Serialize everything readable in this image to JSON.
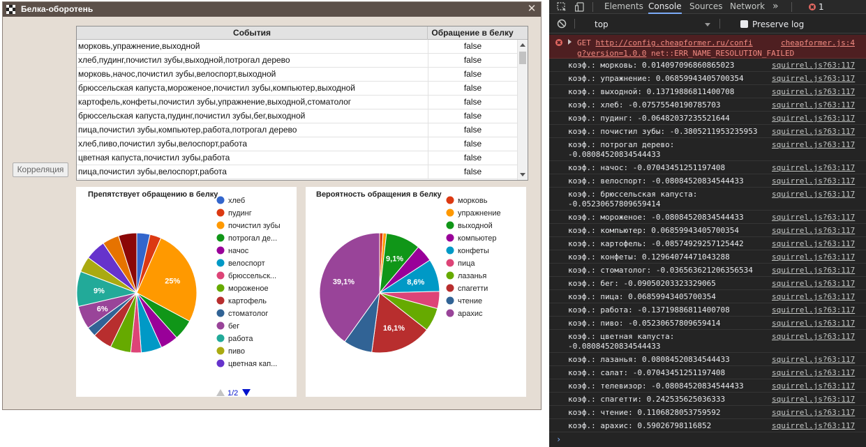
{
  "window": {
    "title": "Белка-оборотень",
    "close_glyph": "✕"
  },
  "table": {
    "col_events": "События",
    "col_result": "Обращение в белку",
    "rows": [
      {
        "events": "морковь,упражнение,выходной",
        "result": "false"
      },
      {
        "events": "хлеб,пудинг,почистил зубы,выходной,потрогал дерево",
        "result": "false"
      },
      {
        "events": "морковь,начос,почистил зубы,велоспорт,выходной",
        "result": "false"
      },
      {
        "events": "брюссельская капуста,мороженое,почистил зубы,компьютер,выходной",
        "result": "false"
      },
      {
        "events": "картофель,конфеты,почистил зубы,упражнение,выходной,стоматолог",
        "result": "false"
      },
      {
        "events": "брюссельская капуста,пудинг,почистил зубы,бег,выходной",
        "result": "false"
      },
      {
        "events": "пица,почистил зубы,компьютер,работа,потрогал дерево",
        "result": "false"
      },
      {
        "events": "хлеб,пиво,почистил зубы,велоспорт,работа",
        "result": "false"
      },
      {
        "events": "цветная капуста,почистил зубы,работа",
        "result": "false"
      },
      {
        "events": "пица,почистил зубы,велоспорт,работа",
        "result": "false"
      }
    ]
  },
  "correlation_button": "Корреляция",
  "chart_data": [
    {
      "type": "pie",
      "title": "Препятствует обращению в белку",
      "slices": [
        {
          "label": "хлеб",
          "value": 3.4,
          "color": "#3366cc"
        },
        {
          "label": "пудинг",
          "value": 2.9,
          "color": "#dc3912"
        },
        {
          "label": "почистил зубы",
          "value": 25,
          "color": "#ff9900",
          "data_label": "25%"
        },
        {
          "label": "потрогал дерево",
          "value": 5.3,
          "color": "#109618"
        },
        {
          "label": "начос",
          "value": 4.6,
          "color": "#990099"
        },
        {
          "label": "велоспорт",
          "value": 5.3,
          "color": "#0099c6"
        },
        {
          "label": "брюссельская капуста",
          "value": 2.7,
          "color": "#dd4477"
        },
        {
          "label": "мороженое",
          "value": 5.3,
          "color": "#66aa00"
        },
        {
          "label": "картофель",
          "value": 5.0,
          "color": "#b82e2e"
        },
        {
          "label": "стоматолог",
          "value": 2.5,
          "color": "#316395"
        },
        {
          "label": "бег",
          "value": 6,
          "color": "#994499",
          "data_label": "6%"
        },
        {
          "label": "работа",
          "value": 9,
          "color": "#22aa99",
          "data_label": "9%"
        },
        {
          "label": "пиво",
          "value": 4.0,
          "color": "#aaaa11"
        },
        {
          "label": "цветная капуста",
          "value": 5.3,
          "color": "#6633cc"
        },
        {
          "label": "",
          "value": 4.3,
          "color": "#e67300"
        },
        {
          "label": "",
          "value": 4.7,
          "color": "#8b0707"
        }
      ],
      "legend": {
        "items": [
          "хлеб",
          "пудинг",
          "почистил зубы",
          "потрогал де...",
          "начос",
          "велоспорт",
          "брюссельск...",
          "мороженое",
          "картофель",
          "стоматолог",
          "бег",
          "работа",
          "пиво",
          "цветная кап..."
        ],
        "position": "right",
        "page": "1/2"
      }
    },
    {
      "type": "pie",
      "title": "Вероятность обращения в белку",
      "slices": [
        {
          "label": "морковь",
          "value": 0.9,
          "color": "#dc3912"
        },
        {
          "label": "упражнение",
          "value": 0.9,
          "color": "#ff9900"
        },
        {
          "label": "выходной",
          "value": 9.1,
          "color": "#109618",
          "data_label": "9,1%"
        },
        {
          "label": "компьютер",
          "value": 4.5,
          "color": "#990099"
        },
        {
          "label": "конфеты",
          "value": 8.6,
          "color": "#0099c6",
          "data_label": "8,6%"
        },
        {
          "label": "пица",
          "value": 4.5,
          "color": "#dd4477"
        },
        {
          "label": "лазанья",
          "value": 6.2,
          "color": "#66aa00"
        },
        {
          "label": "спагетти",
          "value": 16.1,
          "color": "#b82e2e",
          "data_label": "16,1%"
        },
        {
          "label": "чтение",
          "value": 7.6,
          "color": "#316395"
        },
        {
          "label": "арахис",
          "value": 39.1,
          "color": "#994499",
          "data_label": "39,1%"
        }
      ],
      "legend": {
        "items": [
          "морковь",
          "упражнение",
          "выходной",
          "компьютер",
          "конфеты",
          "пица",
          "лазанья",
          "спагетти",
          "чтение",
          "арахис"
        ],
        "position": "right"
      }
    }
  ],
  "devtools": {
    "tabs": [
      "Elements",
      "Console",
      "Sources",
      "Network"
    ],
    "active_tab": "Console",
    "more_glyph": "»",
    "error_count": "1",
    "context": "top",
    "preserve_log": "Preserve log",
    "error": {
      "method": "GET",
      "url": "http://config.cheapformer.ru/config?version=1.0.0",
      "message": "net::ERR_NAME_RESOLUTION_FAILED",
      "source": "cheapformer.js:4"
    },
    "logs": [
      {
        "text": "коэф.: морковь: 0.014097096860865023",
        "source": "squirrel.js?63:117"
      },
      {
        "text": "коэф.: упражнение: 0.06859943405700354",
        "source": "squirrel.js?63:117"
      },
      {
        "text": "коэф.: выходной: 0.13719886811400708",
        "source": "squirrel.js?63:117"
      },
      {
        "text": "коэф.: хлеб: -0.07575540190785703",
        "source": "squirrel.js?63:117"
      },
      {
        "text": "коэф.: пудинг: -0.06482037235521644",
        "source": "squirrel.js?63:117"
      },
      {
        "text": "коэф.: почистил зубы: -0.3805211953235953",
        "source": "squirrel.js?63:117"
      },
      {
        "text": "коэф.: потрогал дерево:\n-0.08084520834544433",
        "source": "squirrel.js?63:117"
      },
      {
        "text": "коэф.: начос: -0.07043451251197408",
        "source": "squirrel.js?63:117"
      },
      {
        "text": "коэф.: велоспорт: -0.08084520834544433",
        "source": "squirrel.js?63:117"
      },
      {
        "text": "коэф.: брюссельская капуста:\n-0.05230657809659414",
        "source": "squirrel.js?63:117"
      },
      {
        "text": "коэф.: мороженое: -0.08084520834544433",
        "source": "squirrel.js?63:117"
      },
      {
        "text": "коэф.: компьютер: 0.06859943405700354",
        "source": "squirrel.js?63:117"
      },
      {
        "text": "коэф.: картофель: -0.08574929257125442",
        "source": "squirrel.js?63:117"
      },
      {
        "text": "коэф.: конфеты: 0.12964074471043288",
        "source": "squirrel.js?63:117"
      },
      {
        "text": "коэф.: стоматолог: -0.036563621206356534",
        "source": "squirrel.js?63:117"
      },
      {
        "text": "коэф.: бег: -0.09050203323329065",
        "source": "squirrel.js?63:117"
      },
      {
        "text": "коэф.: пица: 0.06859943405700354",
        "source": "squirrel.js?63:117"
      },
      {
        "text": "коэф.: работа: -0.13719886811400708",
        "source": "squirrel.js?63:117"
      },
      {
        "text": "коэф.: пиво: -0.05230657809659414",
        "source": "squirrel.js?63:117"
      },
      {
        "text": "коэф.: цветная капуста:\n-0.08084520834544433",
        "source": "squirrel.js?63:117"
      },
      {
        "text": "коэф.: лазанья: 0.08084520834544433",
        "source": "squirrel.js?63:117"
      },
      {
        "text": "коэф.: салат: -0.07043451251197408",
        "source": "squirrel.js?63:117"
      },
      {
        "text": "коэф.: телевизор: -0.08084520834544433",
        "source": "squirrel.js?63:117"
      },
      {
        "text": "коэф.: спагетти: 0.242535625036333",
        "source": "squirrel.js?63:117"
      },
      {
        "text": "коэф.: чтение: 0.1106828053759592",
        "source": "squirrel.js?63:117"
      },
      {
        "text": "коэф.: арахис: 0.59026798116852",
        "source": "squirrel.js?63:117"
      }
    ],
    "prompt_glyph": "›"
  }
}
